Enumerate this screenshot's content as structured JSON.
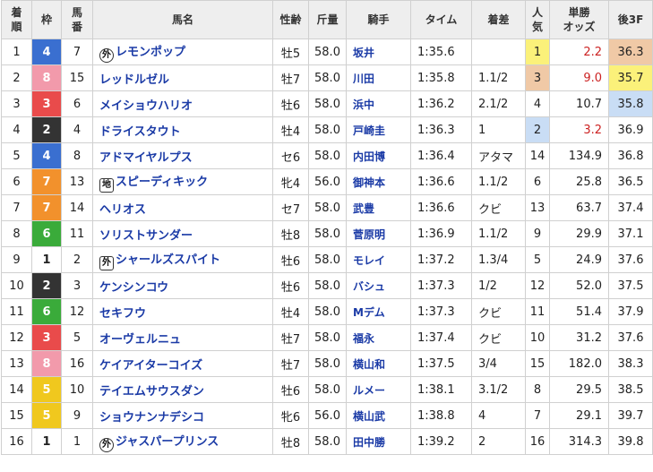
{
  "headers": [
    "着\n順",
    "枠",
    "馬\n番",
    "馬名",
    "性齢",
    "斤量",
    "騎手",
    "タイム",
    "着差",
    "人\n気",
    "単勝\nオッズ",
    "後3F"
  ],
  "colors": {
    "waku": {
      "1": "#ffffff",
      "2": "#333333",
      "3": "#e94b4b",
      "4": "#3a6fd0",
      "5": "#f0c81e",
      "6": "#3aab3a",
      "7": "#f2912c",
      "8": "#f29aab"
    },
    "waku_text": {
      "1": "#222222",
      "2": "#ffffff",
      "3": "#ffffff",
      "4": "#ffffff",
      "5": "#ffffff",
      "6": "#ffffff",
      "7": "#ffffff",
      "8": "#ffffff"
    },
    "last3f_1st": "#fbf17a",
    "last3f_2nd": "#c9ddf5",
    "last3f_3rd": "#f0c9a6"
  },
  "rows": [
    {
      "rank": "1",
      "waku": "4",
      "num": "7",
      "mark": "外",
      "mark_style": "round",
      "name": "レモンポップ",
      "sexage": "牡5",
      "weight": "58.0",
      "jockey": "坂井",
      "time": "1:35.6",
      "margin": "",
      "pop": "1",
      "odds": "2.2",
      "odds_hi": true,
      "last3f": "36.3",
      "l3": "3rd"
    },
    {
      "rank": "2",
      "waku": "8",
      "num": "15",
      "mark": "",
      "name": "レッドルゼル",
      "sexage": "牡7",
      "weight": "58.0",
      "jockey": "川田",
      "time": "1:35.8",
      "margin": "1.1/2",
      "pop": "3",
      "odds": "9.0",
      "odds_hi": true,
      "last3f": "35.7",
      "l3": "1st"
    },
    {
      "rank": "3",
      "waku": "3",
      "num": "6",
      "mark": "",
      "name": "メイショウハリオ",
      "sexage": "牡6",
      "weight": "58.0",
      "jockey": "浜中",
      "time": "1:36.2",
      "margin": "2.1/2",
      "pop": "4",
      "odds": "10.7",
      "odds_hi": false,
      "last3f": "35.8",
      "l3": "2nd"
    },
    {
      "rank": "4",
      "waku": "2",
      "num": "4",
      "mark": "",
      "name": "ドライスタウト",
      "sexage": "牡4",
      "weight": "58.0",
      "jockey": "戸崎圭",
      "time": "1:36.3",
      "margin": "1",
      "pop": "2",
      "odds": "3.2",
      "odds_hi": true,
      "last3f": "36.9",
      "l3": ""
    },
    {
      "rank": "5",
      "waku": "4",
      "num": "8",
      "mark": "",
      "name": "アドマイヤルプス",
      "sexage": "セ6",
      "weight": "58.0",
      "jockey": "内田博",
      "time": "1:36.4",
      "margin": "アタマ",
      "pop": "14",
      "odds": "134.9",
      "odds_hi": false,
      "last3f": "36.8",
      "l3": ""
    },
    {
      "rank": "6",
      "waku": "7",
      "num": "13",
      "mark": "地",
      "mark_style": "square",
      "name": "スピーディキック",
      "sexage": "牝4",
      "weight": "56.0",
      "jockey": "御神本",
      "time": "1:36.6",
      "margin": "1.1/2",
      "pop": "6",
      "odds": "25.8",
      "odds_hi": false,
      "last3f": "36.5",
      "l3": ""
    },
    {
      "rank": "7",
      "waku": "7",
      "num": "14",
      "mark": "",
      "name": "ヘリオス",
      "sexage": "セ7",
      "weight": "58.0",
      "jockey": "武豊",
      "time": "1:36.6",
      "margin": "クビ",
      "pop": "13",
      "odds": "63.7",
      "odds_hi": false,
      "last3f": "37.4",
      "l3": ""
    },
    {
      "rank": "8",
      "waku": "6",
      "num": "11",
      "mark": "",
      "name": "ソリストサンダー",
      "sexage": "牡8",
      "weight": "58.0",
      "jockey": "菅原明",
      "time": "1:36.9",
      "margin": "1.1/2",
      "pop": "9",
      "odds": "29.9",
      "odds_hi": false,
      "last3f": "37.1",
      "l3": ""
    },
    {
      "rank": "9",
      "waku": "1",
      "num": "2",
      "mark": "外",
      "mark_style": "square",
      "name": "シャールズスパイト",
      "sexage": "牡6",
      "weight": "58.0",
      "jockey": "モレイ",
      "time": "1:37.2",
      "margin": "1.3/4",
      "pop": "5",
      "odds": "24.9",
      "odds_hi": false,
      "last3f": "37.6",
      "l3": ""
    },
    {
      "rank": "10",
      "waku": "2",
      "num": "3",
      "mark": "",
      "name": "ケンシンコウ",
      "sexage": "牡6",
      "weight": "58.0",
      "jockey": "バシュ",
      "time": "1:37.3",
      "margin": "1/2",
      "pop": "12",
      "odds": "52.0",
      "odds_hi": false,
      "last3f": "37.5",
      "l3": ""
    },
    {
      "rank": "11",
      "waku": "6",
      "num": "12",
      "mark": "",
      "name": "セキフウ",
      "sexage": "牡4",
      "weight": "58.0",
      "jockey": "Mデム",
      "time": "1:37.3",
      "margin": "クビ",
      "pop": "11",
      "odds": "51.4",
      "odds_hi": false,
      "last3f": "37.9",
      "l3": ""
    },
    {
      "rank": "12",
      "waku": "3",
      "num": "5",
      "mark": "",
      "name": "オーヴェルニュ",
      "sexage": "牡7",
      "weight": "58.0",
      "jockey": "福永",
      "time": "1:37.4",
      "margin": "クビ",
      "pop": "10",
      "odds": "31.2",
      "odds_hi": false,
      "last3f": "37.6",
      "l3": ""
    },
    {
      "rank": "13",
      "waku": "8",
      "num": "16",
      "mark": "",
      "name": "ケイアイターコイズ",
      "sexage": "牡7",
      "weight": "58.0",
      "jockey": "横山和",
      "time": "1:37.5",
      "margin": "3/4",
      "pop": "15",
      "odds": "182.0",
      "odds_hi": false,
      "last3f": "38.3",
      "l3": ""
    },
    {
      "rank": "14",
      "waku": "5",
      "num": "10",
      "mark": "",
      "name": "テイエムサウスダン",
      "sexage": "牡6",
      "weight": "58.0",
      "jockey": "ルメー",
      "time": "1:38.1",
      "margin": "3.1/2",
      "pop": "8",
      "odds": "29.5",
      "odds_hi": false,
      "last3f": "38.5",
      "l3": ""
    },
    {
      "rank": "15",
      "waku": "5",
      "num": "9",
      "mark": "",
      "name": "ショウナンナデシコ",
      "sexage": "牝6",
      "weight": "56.0",
      "jockey": "横山武",
      "time": "1:38.8",
      "margin": "4",
      "pop": "7",
      "odds": "29.1",
      "odds_hi": false,
      "last3f": "39.7",
      "l3": ""
    },
    {
      "rank": "16",
      "waku": "1",
      "num": "1",
      "mark": "外",
      "mark_style": "round",
      "name": "ジャスパープリンス",
      "sexage": "牡8",
      "weight": "58.0",
      "jockey": "田中勝",
      "time": "1:39.2",
      "margin": "2",
      "pop": "16",
      "odds": "314.3",
      "odds_hi": false,
      "last3f": "39.8",
      "l3": ""
    }
  ]
}
